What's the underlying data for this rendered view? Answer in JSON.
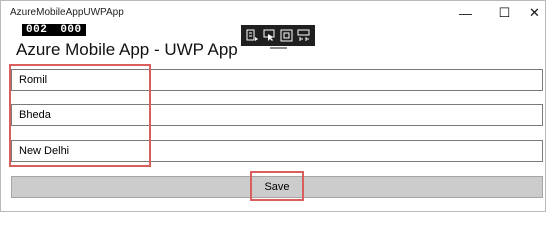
{
  "window": {
    "title": "AzureMobileAppUWPApp",
    "minimize_glyph": "—",
    "maximize_glyph": "☐",
    "close_glyph": "✕"
  },
  "frame_counter": {
    "left": "002",
    "right": "000"
  },
  "debug_toolbar": {
    "icons": [
      "live-visual-tree-icon",
      "select-element-icon",
      "display-layout-adorners-icon",
      "track-focus-icon"
    ]
  },
  "app": {
    "heading": "Azure Mobile App - UWP App",
    "fields": [
      {
        "value": "Romil"
      },
      {
        "value": "Bheda"
      },
      {
        "value": "New Delhi"
      }
    ],
    "save_label": "Save"
  },
  "colors": {
    "highlight": "#d95f5f",
    "button_bg": "#cccccc",
    "debug_bar_bg": "#1f1f1f"
  }
}
